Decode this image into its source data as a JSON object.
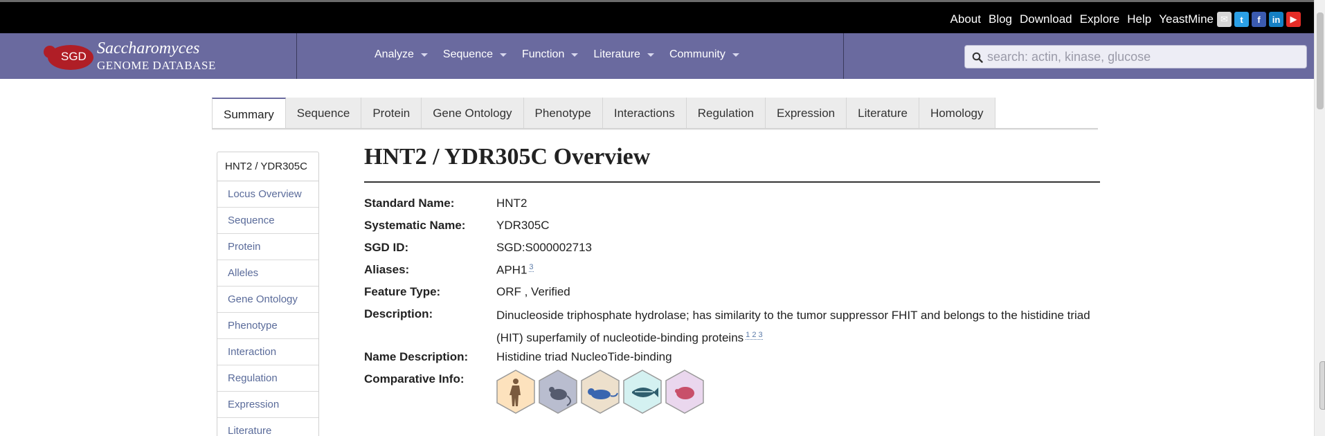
{
  "toplinks": [
    "About",
    "Blog",
    "Download",
    "Explore",
    "Help",
    "YeastMine"
  ],
  "social_icons": [
    {
      "name": "email-icon",
      "color": "#d6d6d6",
      "glyph": "✉"
    },
    {
      "name": "twitter-icon",
      "color": "#2ba0e6",
      "glyph": "t"
    },
    {
      "name": "facebook-icon",
      "color": "#3b5bb0",
      "glyph": "f"
    },
    {
      "name": "linkedin-icon",
      "color": "#1580c4",
      "glyph": "in"
    },
    {
      "name": "youtube-icon",
      "color": "#e52d27",
      "glyph": "▶"
    }
  ],
  "logo": {
    "badge": "SGD",
    "line1": "Saccharomyces",
    "line2": "GENOME DATABASE",
    "badge_color": "#b01e26"
  },
  "menu": [
    "Analyze",
    "Sequence",
    "Function",
    "Literature",
    "Community"
  ],
  "search": {
    "placeholder": "search: actin, kinase, glucose"
  },
  "tabs": [
    "Summary",
    "Sequence",
    "Protein",
    "Gene Ontology",
    "Phenotype",
    "Interactions",
    "Regulation",
    "Expression",
    "Literature",
    "Homology"
  ],
  "sidebar": {
    "header": "HNT2 / YDR305C",
    "items": [
      "Locus Overview",
      "Sequence",
      "Protein",
      "Alleles",
      "Gene Ontology",
      "Phenotype",
      "Interaction",
      "Regulation",
      "Expression",
      "Literature"
    ]
  },
  "main": {
    "title": "HNT2 / YDR305C Overview",
    "fields": {
      "standard_name": {
        "label": "Standard Name:",
        "value": "HNT2"
      },
      "systematic_name": {
        "label": "Systematic Name:",
        "value": "YDR305C"
      },
      "sgd_id": {
        "label": "SGD ID:",
        "value": "SGD:S000002713"
      },
      "aliases": {
        "label": "Aliases:",
        "value": "APH1",
        "refs": "3"
      },
      "feature_type": {
        "label": "Feature Type:",
        "value": "ORF , Verified"
      },
      "description": {
        "label": "Description:",
        "value": "Dinucleoside triphosphate hydrolase; has similarity to the tumor suppressor FHIT and belongs to the histidine triad (HIT) superfamily of nucleotide-binding proteins",
        "refs": "1 2 3"
      },
      "name_description": {
        "label": "Name Description:",
        "value": "Histidine triad NucleoTide-binding"
      },
      "comparative_info": {
        "label": "Comparative Info:"
      }
    },
    "species_icons": [
      {
        "name": "human-icon",
        "fill": "#fde2bd"
      },
      {
        "name": "mouse-icon",
        "fill": "#b9bdcf"
      },
      {
        "name": "rat-icon",
        "fill": "#ede0cc"
      },
      {
        "name": "zebrafish-icon",
        "fill": "#d4f1f1"
      },
      {
        "name": "fly-icon",
        "fill": "#ead7ee"
      }
    ]
  }
}
